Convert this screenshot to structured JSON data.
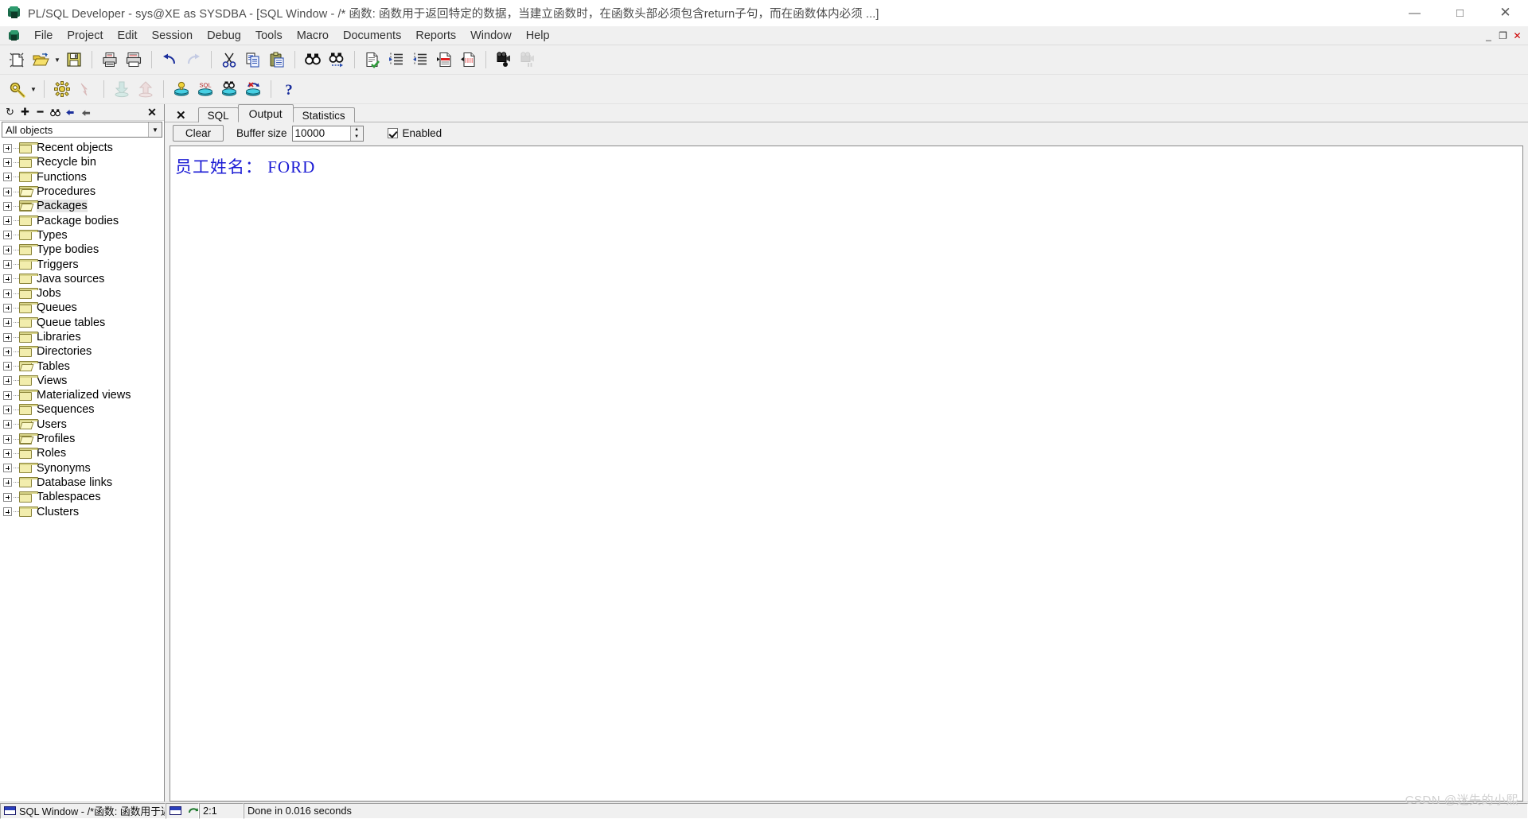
{
  "window": {
    "title": "PL/SQL Developer - sys@XE as SYSDBA - [SQL Window - /* 函数: 函数用于返回特定的数据，当建立函数时，在函数头部必须包含return子句，而在函数体内必须 ...]",
    "app_icon": "plsql-developer-icon",
    "minimize": "—",
    "maximize": "□",
    "close": "✕"
  },
  "menubar": {
    "items": [
      {
        "label": "File"
      },
      {
        "label": "Project"
      },
      {
        "label": "Edit"
      },
      {
        "label": "Session"
      },
      {
        "label": "Debug"
      },
      {
        "label": "Tools"
      },
      {
        "label": "Macro"
      },
      {
        "label": "Documents"
      },
      {
        "label": "Reports"
      },
      {
        "label": "Window"
      },
      {
        "label": "Help"
      }
    ],
    "mdi_restore": "_",
    "mdi_maximize": "❐",
    "mdi_close": "✕"
  },
  "toolbar_top": {
    "buttons": [
      {
        "name": "new-icon",
        "tip": "New"
      },
      {
        "name": "open-icon",
        "tip": "Open"
      },
      {
        "name": "open-dropdown-icon",
        "tip": "Open recent"
      },
      {
        "name": "save-icon",
        "tip": "Save"
      },
      {
        "name": "print-icon",
        "tip": "Print"
      },
      {
        "name": "print-preview-icon",
        "tip": "Print preview"
      },
      {
        "name": "undo-icon",
        "tip": "Undo"
      },
      {
        "name": "redo-icon",
        "tip": "Redo"
      },
      {
        "name": "cut-icon",
        "tip": "Cut"
      },
      {
        "name": "copy-icon",
        "tip": "Copy"
      },
      {
        "name": "paste-icon",
        "tip": "Paste"
      },
      {
        "name": "find-icon",
        "tip": "Find"
      },
      {
        "name": "find-next-icon",
        "tip": "Find next"
      },
      {
        "name": "check-syntax-icon",
        "tip": "Check syntax"
      },
      {
        "name": "indent-icon",
        "tip": "Indent"
      },
      {
        "name": "outdent-icon",
        "tip": "Outdent"
      },
      {
        "name": "comment-icon",
        "tip": "Comment"
      },
      {
        "name": "uncomment-icon",
        "tip": "Uncomment"
      },
      {
        "name": "record-macro-icon",
        "tip": "Record macro"
      },
      {
        "name": "play-macro-icon",
        "tip": "Play macro"
      }
    ]
  },
  "toolbar_bottom": {
    "buttons": [
      {
        "name": "execute-icon",
        "tip": "Execute"
      },
      {
        "name": "execute-dropdown-icon",
        "tip": "Execute options"
      },
      {
        "name": "break-icon",
        "tip": "Break"
      },
      {
        "name": "run-script-icon",
        "tip": "Run script"
      },
      {
        "name": "import-icon",
        "tip": "Import"
      },
      {
        "name": "export-icon",
        "tip": "Export"
      },
      {
        "name": "explain-plan-icon",
        "tip": "Explain plan"
      },
      {
        "name": "sql-window-icon",
        "tip": "New SQL window"
      },
      {
        "name": "find-db-object-icon",
        "tip": "Find database object"
      },
      {
        "name": "rollback-icon",
        "tip": "Rollback"
      },
      {
        "name": "help-icon",
        "tip": "Help"
      }
    ]
  },
  "sidebar": {
    "toolbar": [
      {
        "name": "refresh-icon",
        "glyph": "↻"
      },
      {
        "name": "add-icon",
        "glyph": "✚"
      },
      {
        "name": "remove-icon",
        "glyph": "━"
      },
      {
        "name": "find-icon",
        "glyph": "🕶"
      },
      {
        "name": "filter-icon",
        "glyph": "◤"
      },
      {
        "name": "organize-icon",
        "glyph": "◣"
      }
    ],
    "close_label": "✕",
    "filter": {
      "value": "All objects",
      "dropdown_icon": "chevron-down-icon"
    },
    "tree": [
      {
        "label": "Recent objects",
        "open": false
      },
      {
        "label": "Recycle bin",
        "open": false
      },
      {
        "label": "Functions",
        "open": false
      },
      {
        "label": "Procedures",
        "open": true
      },
      {
        "label": "Packages",
        "open": true,
        "selected": true
      },
      {
        "label": "Package bodies",
        "open": false
      },
      {
        "label": "Types",
        "open": false
      },
      {
        "label": "Type bodies",
        "open": false
      },
      {
        "label": "Triggers",
        "open": false
      },
      {
        "label": "Java sources",
        "open": false
      },
      {
        "label": "Jobs",
        "open": false
      },
      {
        "label": "Queues",
        "open": false
      },
      {
        "label": "Queue tables",
        "open": false
      },
      {
        "label": "Libraries",
        "open": false
      },
      {
        "label": "Directories",
        "open": false
      },
      {
        "label": "Tables",
        "open": true
      },
      {
        "label": "Views",
        "open": false
      },
      {
        "label": "Materialized views",
        "open": false
      },
      {
        "label": "Sequences",
        "open": false
      },
      {
        "label": "Users",
        "open": true
      },
      {
        "label": "Profiles",
        "open": true
      },
      {
        "label": "Roles",
        "open": false
      },
      {
        "label": "Synonyms",
        "open": false
      },
      {
        "label": "Database links",
        "open": false
      },
      {
        "label": "Tablespaces",
        "open": false
      },
      {
        "label": "Clusters",
        "open": false
      }
    ]
  },
  "main": {
    "close_label": "✕",
    "tabs": [
      {
        "label": "SQL",
        "active": false
      },
      {
        "label": "Output",
        "active": true
      },
      {
        "label": "Statistics",
        "active": false
      }
    ],
    "output_toolbar": {
      "clear_label": "Clear",
      "buffer_label": "Buffer size",
      "buffer_value": "10000",
      "enabled_label": "Enabled",
      "enabled_checked": true
    },
    "output_text": "员工姓名： FORD"
  },
  "statusbar": {
    "document": "SQL Window - /*函数: 函数用于返|",
    "window_icon": "sql-window-icon",
    "session_icon": "connection-icon",
    "position": "2:1",
    "message": "Done in 0.016 seconds"
  },
  "watermark": "CSDN @迷失的小熙",
  "colors": {
    "output_text": "#1b1bd4",
    "window_bg": "#f0f0f0",
    "panel_bg": "#ffffff",
    "title_text": "#4d4d4d"
  }
}
